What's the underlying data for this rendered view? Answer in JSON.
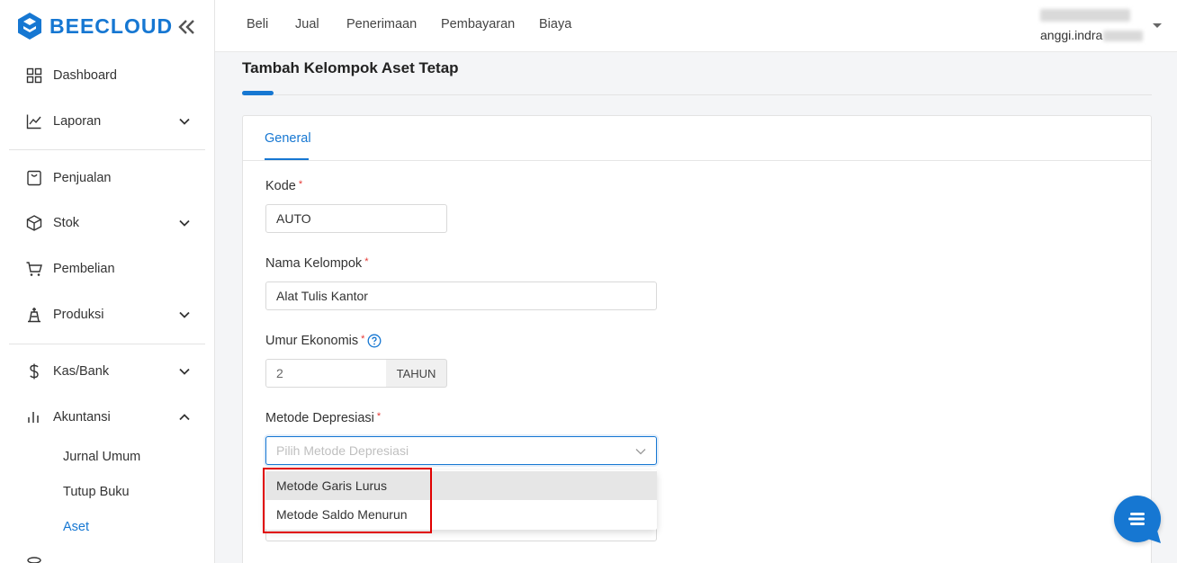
{
  "brand": {
    "name": "BEECLOUD",
    "color": "#1677d2"
  },
  "sidebar": {
    "items": [
      {
        "label": "Dashboard",
        "icon": "dashboard-grid-icon"
      },
      {
        "label": "Laporan",
        "icon": "chart-line-icon",
        "expandable": true
      },
      {
        "label": "Penjualan",
        "icon": "shopping-bag-icon"
      },
      {
        "label": "Stok",
        "icon": "box-icon",
        "expandable": true
      },
      {
        "label": "Pembelian",
        "icon": "cart-icon"
      },
      {
        "label": "Produksi",
        "icon": "factory-icon",
        "expandable": true
      },
      {
        "label": "Kas/Bank",
        "icon": "dollar-icon",
        "expandable": true
      },
      {
        "label": "Akuntansi",
        "icon": "bar-chart-icon",
        "expandable": true,
        "expanded": true
      }
    ],
    "sub_items": [
      {
        "label": "Jurnal Umum"
      },
      {
        "label": "Tutup Buku"
      },
      {
        "label": "Aset",
        "active": true
      }
    ]
  },
  "header": {
    "menu": [
      "Beli",
      "Jual",
      "Penerimaan",
      "Pembayaran",
      "Biaya"
    ],
    "user_email": "anggi.indra"
  },
  "page": {
    "title": "Tambah Kelompok Aset Tetap",
    "tab": "General"
  },
  "form": {
    "kode": {
      "label": "Kode",
      "value": "AUTO"
    },
    "nama_kelompok": {
      "label": "Nama Kelompok",
      "value": "Alat Tulis Kantor"
    },
    "umur_ekonomis": {
      "label": "Umur Ekonomis",
      "value": "2",
      "unit": "TAHUN"
    },
    "metode_depresiasi": {
      "label": "Metode Depresiasi",
      "placeholder": "Pilih Metode Depresiasi",
      "options": [
        "Metode Garis Lurus",
        "Metode Saldo Menurun"
      ]
    }
  },
  "required_marker": "*"
}
